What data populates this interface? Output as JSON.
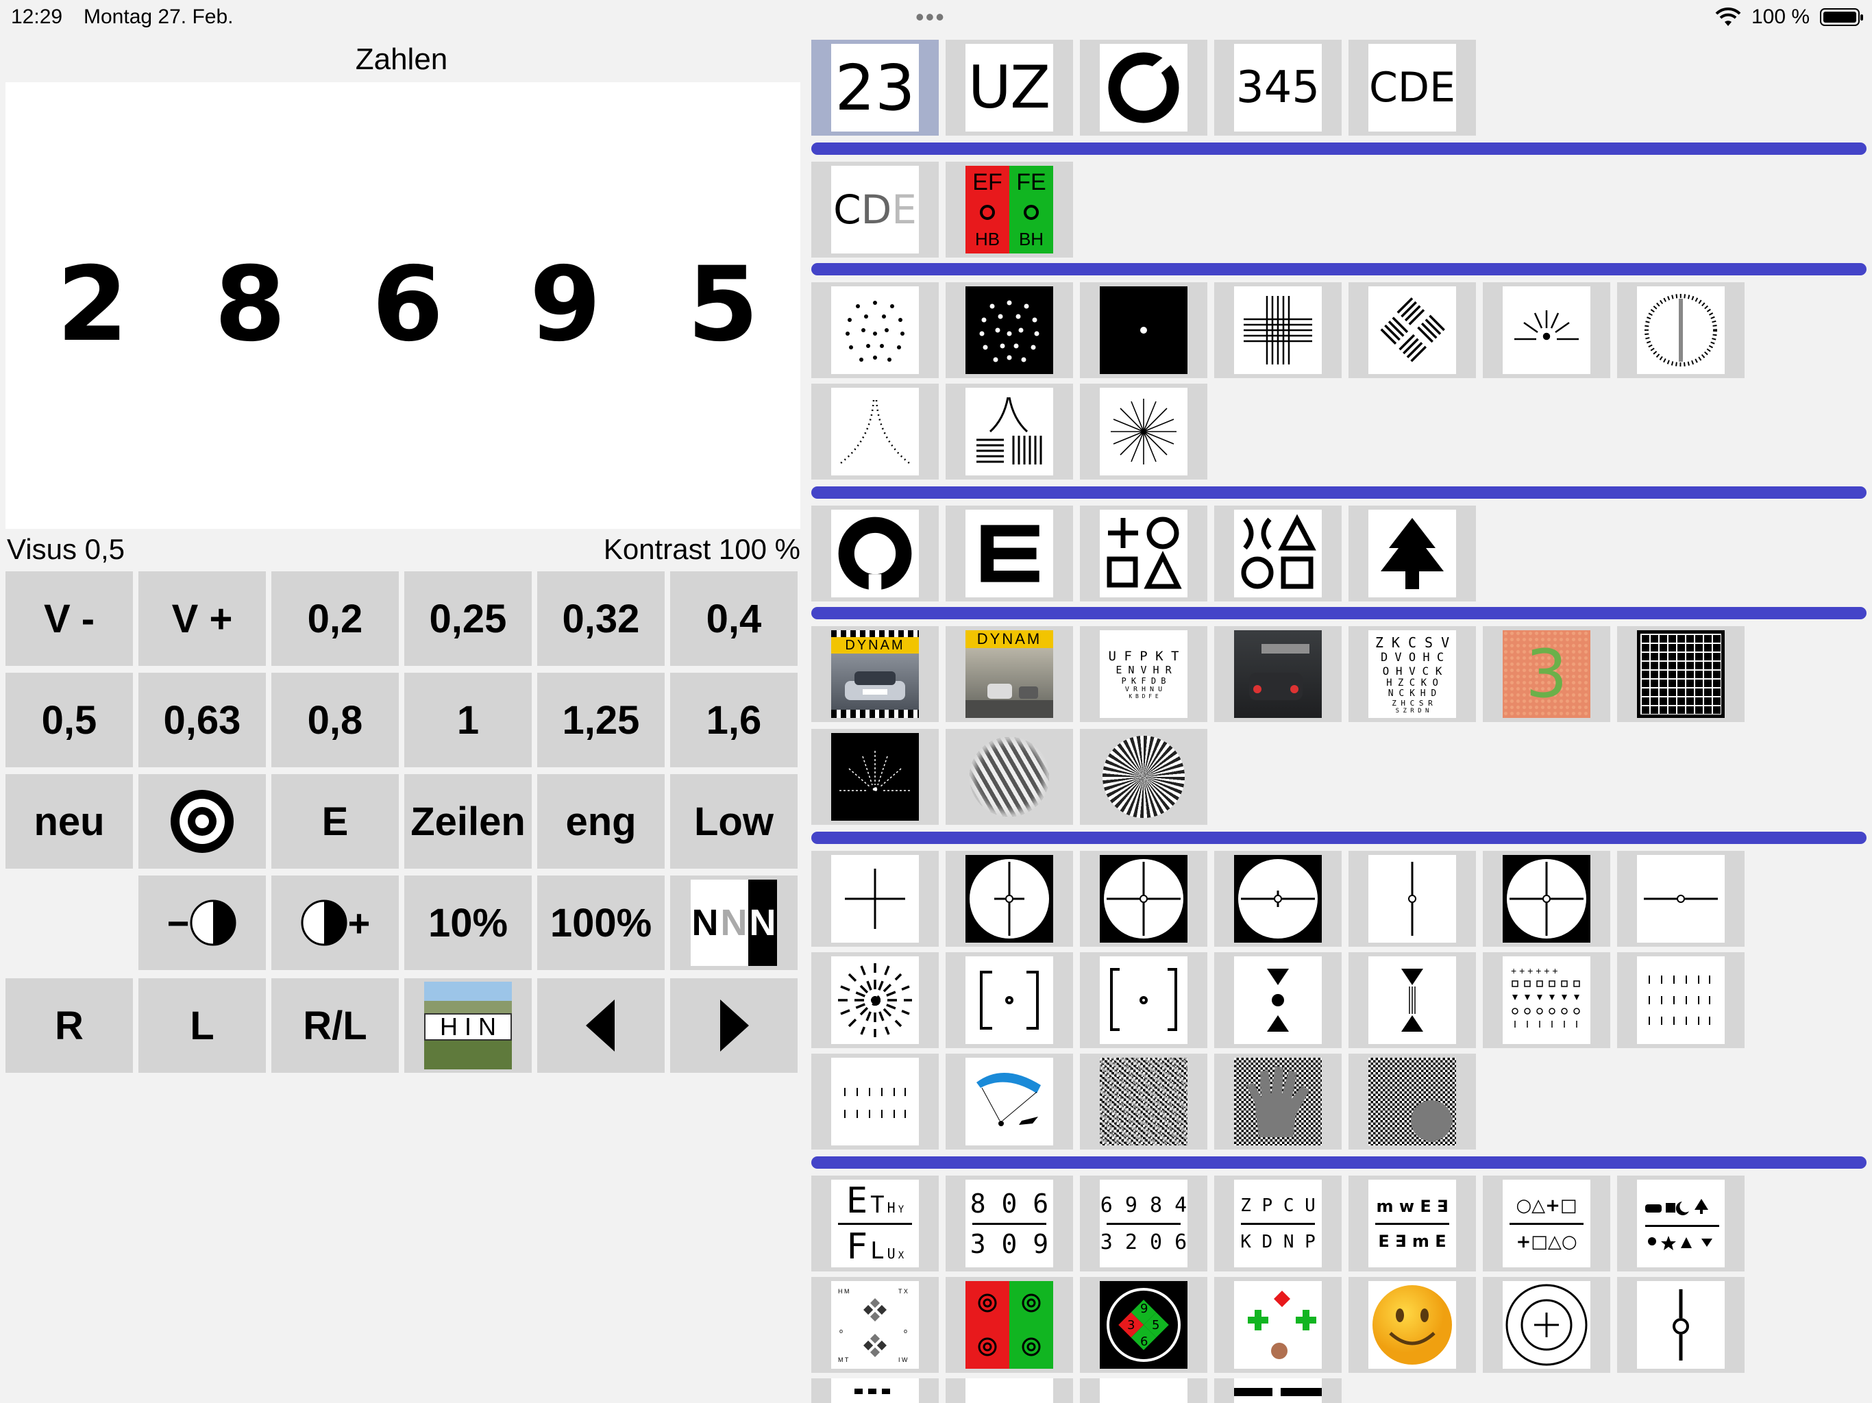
{
  "status": {
    "time": "12:29",
    "date": "Montag 27. Feb.",
    "dots": "•••",
    "battery": "100 %"
  },
  "display": {
    "mode_title": "Zahlen",
    "digits": [
      "2",
      "8",
      "6",
      "9",
      "5"
    ],
    "visus_label": "Visus  0,5",
    "kontrast_label": "Kontrast  100 %"
  },
  "keypad": {
    "row1": [
      "V -",
      "V +",
      "0,2",
      "0,25",
      "0,32",
      "0,4"
    ],
    "row2": [
      "0,5",
      "0,63",
      "0,8",
      "1",
      "1,25",
      "1,6"
    ],
    "row3": [
      "neu",
      "target-icon",
      "E",
      "Zeilen",
      "eng",
      "Low"
    ],
    "row4": [
      "contrast-minus-icon",
      "contrast-plus-icon",
      "10%",
      "100%",
      "NNN"
    ],
    "row5": [
      "R",
      "L",
      "R/L",
      "HIN",
      "arrow-left-icon",
      "arrow-right-icon"
    ],
    "contrast_minus_text": "−",
    "contrast_plus_text": "+",
    "nnn_letters": [
      "N",
      "N",
      "N"
    ],
    "hin_text": "H I N"
  },
  "tiles": {
    "t_numbers": "23",
    "t_letters_uz": "UZ",
    "t_digits_345": "345",
    "t_letters_cde": "CDE",
    "t_letters_cde_contrast": "CDE",
    "t_red_green": {
      "top_left": "EF",
      "top_right": "FE",
      "bottom_left": "HB",
      "bottom_right": "BH"
    },
    "t_dynam": "DYNAM",
    "t_dynam_2": "DYNAM",
    "t_chart_lines": [
      "U F P K T",
      "E N V H R",
      "P K F D B",
      "V R H N U",
      "K B D F E"
    ],
    "t_chart_lines_2": [
      "Z K C S V",
      "D V O H C",
      "O H V C K",
      "H Z C K O",
      "N C K H D",
      "Z H C S R",
      "S Z R D N"
    ],
    "t_ishihara": "3",
    "t_ethy_top": [
      "E",
      "T",
      "H",
      "Y"
    ],
    "t_ethy_bottom": [
      "F",
      "L",
      "U",
      "X"
    ],
    "t_806_top": "8 0 6",
    "t_806_bottom": "3 0 9",
    "t_6984_top": "6 9 8 4",
    "t_6984_bottom": "3 2 0 6",
    "t_zpcu_top": "Z P C U",
    "t_zpcu_bottom": "K D N P",
    "t_mwe_top": "m w E ∃",
    "t_mwe_bottom": "E ∃ m E",
    "t_shapes_top": "○△+□",
    "t_shapes_bottom": "+□△○",
    "t_worth_numbers": [
      "9",
      "3",
      "5",
      "6"
    ]
  },
  "colors": {
    "separator": "#4444c8",
    "tile_bg": "#d6d6d6",
    "tile_selected": "#a7b0cc",
    "key_bg": "#d4d4d4",
    "red": "#e8191c",
    "green": "#11b521"
  }
}
